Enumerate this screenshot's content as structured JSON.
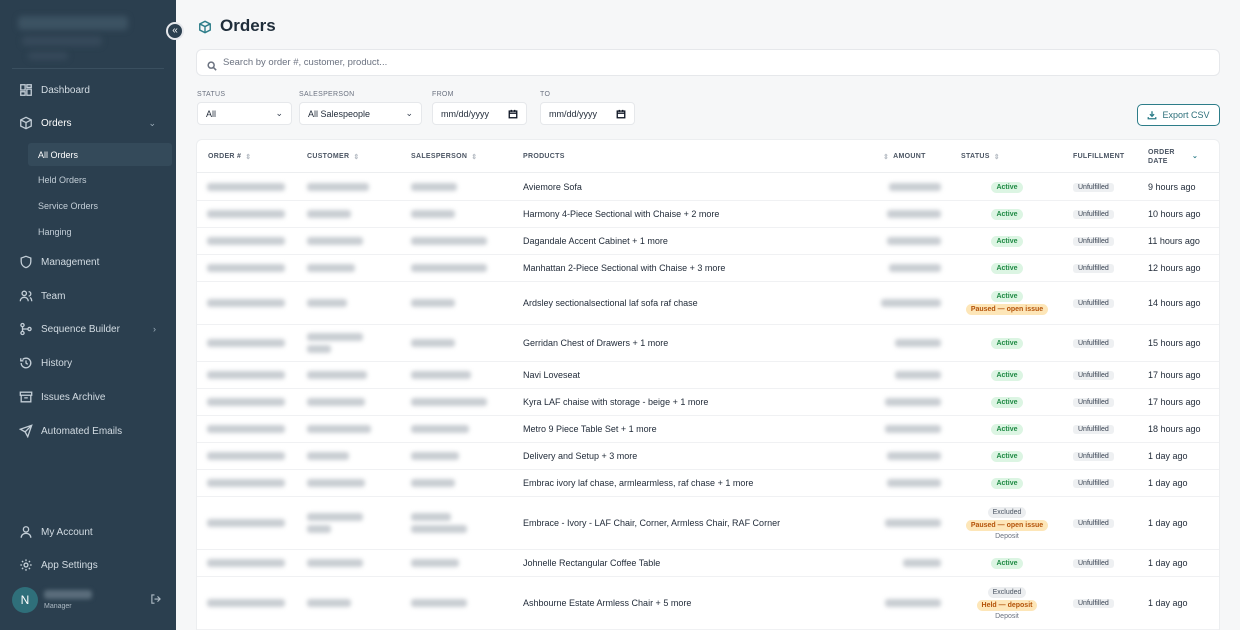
{
  "sidebar": {
    "collapse_icon": "double-chevron-left-icon",
    "items": [
      {
        "label": "Dashboard",
        "icon": "dashboard-icon"
      },
      {
        "label": "Orders",
        "icon": "box-icon"
      },
      {
        "label": "Management",
        "icon": "shield-icon"
      },
      {
        "label": "Team",
        "icon": "users-icon"
      },
      {
        "label": "Sequence Builder",
        "icon": "workflow-icon"
      },
      {
        "label": "History",
        "icon": "history-icon"
      },
      {
        "label": "Issues Archive",
        "icon": "archive-icon"
      },
      {
        "label": "Automated Emails",
        "icon": "send-icon"
      }
    ],
    "orders_sub": [
      "All Orders",
      "Held Orders",
      "Service Orders",
      "Hanging"
    ],
    "bottom": [
      {
        "label": "My Account",
        "icon": "user-icon"
      },
      {
        "label": "App Settings",
        "icon": "gear-icon"
      }
    ],
    "user": {
      "initial": "N",
      "role": "Manager"
    }
  },
  "page": {
    "title": "Orders",
    "title_icon": "box-icon"
  },
  "search": {
    "placeholder": "Search by order #, customer, product..."
  },
  "filters": {
    "status": {
      "label": "STATUS",
      "value": "All"
    },
    "salesperson": {
      "label": "SALESPERSON",
      "value": "All Salespeople"
    },
    "from": {
      "label": "FROM",
      "value": "mm/dd/yyyy"
    },
    "to": {
      "label": "TO",
      "value": "mm/dd/yyyy"
    }
  },
  "export": {
    "label": "Export CSV"
  },
  "table": {
    "headers": {
      "order": "ORDER #",
      "customer": "CUSTOMER",
      "salesperson": "SALESPERSON",
      "products": "PRODUCTS",
      "amount": "AMOUNT",
      "status": "STATUS",
      "fulfillment": "FULFILLMENT",
      "date": "ORDER DATE"
    },
    "rows": [
      {
        "products": "Aviemore Sofa",
        "statuses": [
          {
            "t": "Active",
            "k": "active"
          }
        ],
        "fulfillment": "Unfulfilled",
        "date": "9 hours ago"
      },
      {
        "products": "Harmony 4-Piece Sectional with Chaise + 2 more",
        "statuses": [
          {
            "t": "Active",
            "k": "active"
          }
        ],
        "fulfillment": "Unfulfilled",
        "date": "10 hours ago"
      },
      {
        "products": "Dagandale Accent Cabinet + 1 more",
        "statuses": [
          {
            "t": "Active",
            "k": "active"
          }
        ],
        "fulfillment": "Unfulfilled",
        "date": "11 hours ago"
      },
      {
        "products": "Manhattan 2-Piece Sectional with Chaise + 3 more",
        "statuses": [
          {
            "t": "Active",
            "k": "active"
          }
        ],
        "fulfillment": "Unfulfilled",
        "date": "12 hours ago"
      },
      {
        "products": "Ardsley sectionalsectional laf sofa raf chase",
        "statuses": [
          {
            "t": "Active",
            "k": "active"
          },
          {
            "t": "Paused — open issue",
            "k": "paused"
          }
        ],
        "fulfillment": "Unfulfilled",
        "date": "14 hours ago"
      },
      {
        "products": "Gerridan Chest of Drawers + 1 more",
        "statuses": [
          {
            "t": "Active",
            "k": "active"
          }
        ],
        "fulfillment": "Unfulfilled",
        "date": "15 hours ago"
      },
      {
        "products": "Navi Loveseat",
        "statuses": [
          {
            "t": "Active",
            "k": "active"
          }
        ],
        "fulfillment": "Unfulfilled",
        "date": "17 hours ago"
      },
      {
        "products": "Kyra LAF chaise with storage - beige + 1 more",
        "statuses": [
          {
            "t": "Active",
            "k": "active"
          }
        ],
        "fulfillment": "Unfulfilled",
        "date": "17 hours ago"
      },
      {
        "products": "Metro 9 Piece Table Set + 1 more",
        "statuses": [
          {
            "t": "Active",
            "k": "active"
          }
        ],
        "fulfillment": "Unfulfilled",
        "date": "18 hours ago"
      },
      {
        "products": "Delivery and Setup + 3 more",
        "statuses": [
          {
            "t": "Active",
            "k": "active"
          }
        ],
        "fulfillment": "Unfulfilled",
        "date": "1 day ago"
      },
      {
        "products": "Embrac ivory laf chase, armlearmless, raf chase + 1 more",
        "statuses": [
          {
            "t": "Active",
            "k": "active"
          }
        ],
        "fulfillment": "Unfulfilled",
        "date": "1 day ago"
      },
      {
        "products": "Embrace - Ivory - LAF Chair, Corner, Armless Chair, RAF Corner",
        "statuses": [
          {
            "t": "Excluded",
            "k": "excluded"
          },
          {
            "t": "Paused — open issue",
            "k": "paused"
          },
          {
            "t": "Deposit",
            "k": "sub"
          }
        ],
        "fulfillment": "Unfulfilled",
        "date": "1 day ago"
      },
      {
        "products": "Johnelle Rectangular Coffee Table",
        "statuses": [
          {
            "t": "Active",
            "k": "active"
          }
        ],
        "fulfillment": "Unfulfilled",
        "date": "1 day ago"
      },
      {
        "products": "Ashbourne Estate Armless Chair + 5 more",
        "statuses": [
          {
            "t": "Excluded",
            "k": "excluded"
          },
          {
            "t": "Held — deposit",
            "k": "held"
          },
          {
            "t": "Deposit",
            "k": "sub"
          }
        ],
        "fulfillment": "Unfulfilled",
        "date": "1 day ago"
      }
    ]
  }
}
